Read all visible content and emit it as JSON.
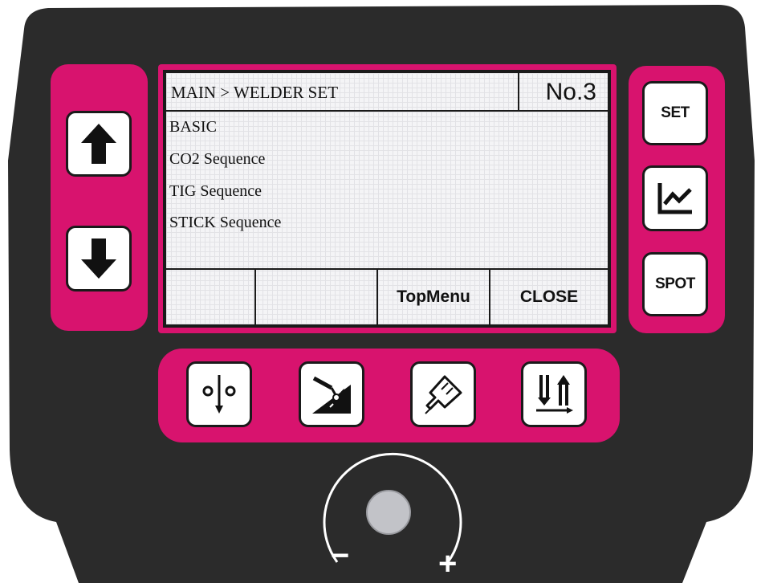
{
  "colors": {
    "panel": "#2b2b2b",
    "accent": "#d8136e",
    "screen_bg": "#f4f4f6",
    "key_bg": "#ffffff"
  },
  "screen": {
    "breadcrumb": "MAIN > WELDER SET",
    "program_no": "No.3",
    "menu_items": [
      "BASIC",
      "CO2 Sequence",
      "TIG Sequence",
      "STICK Sequence"
    ],
    "softkeys": [
      "",
      "",
      "TopMenu",
      "CLOSE"
    ]
  },
  "left_keys": {
    "up_icon": "arrow-up-icon",
    "down_icon": "arrow-down-icon"
  },
  "right_keys": {
    "set_label": "SET",
    "graph_icon": "waveform-graph-icon",
    "spot_label": "SPOT"
  },
  "function_keys": {
    "icons": [
      "torch-trigger-icon",
      "arc-welding-icon",
      "gas-purge-icon",
      "wire-inch-icon"
    ]
  },
  "knob": {
    "minus_label": "−",
    "plus_label": "+"
  }
}
